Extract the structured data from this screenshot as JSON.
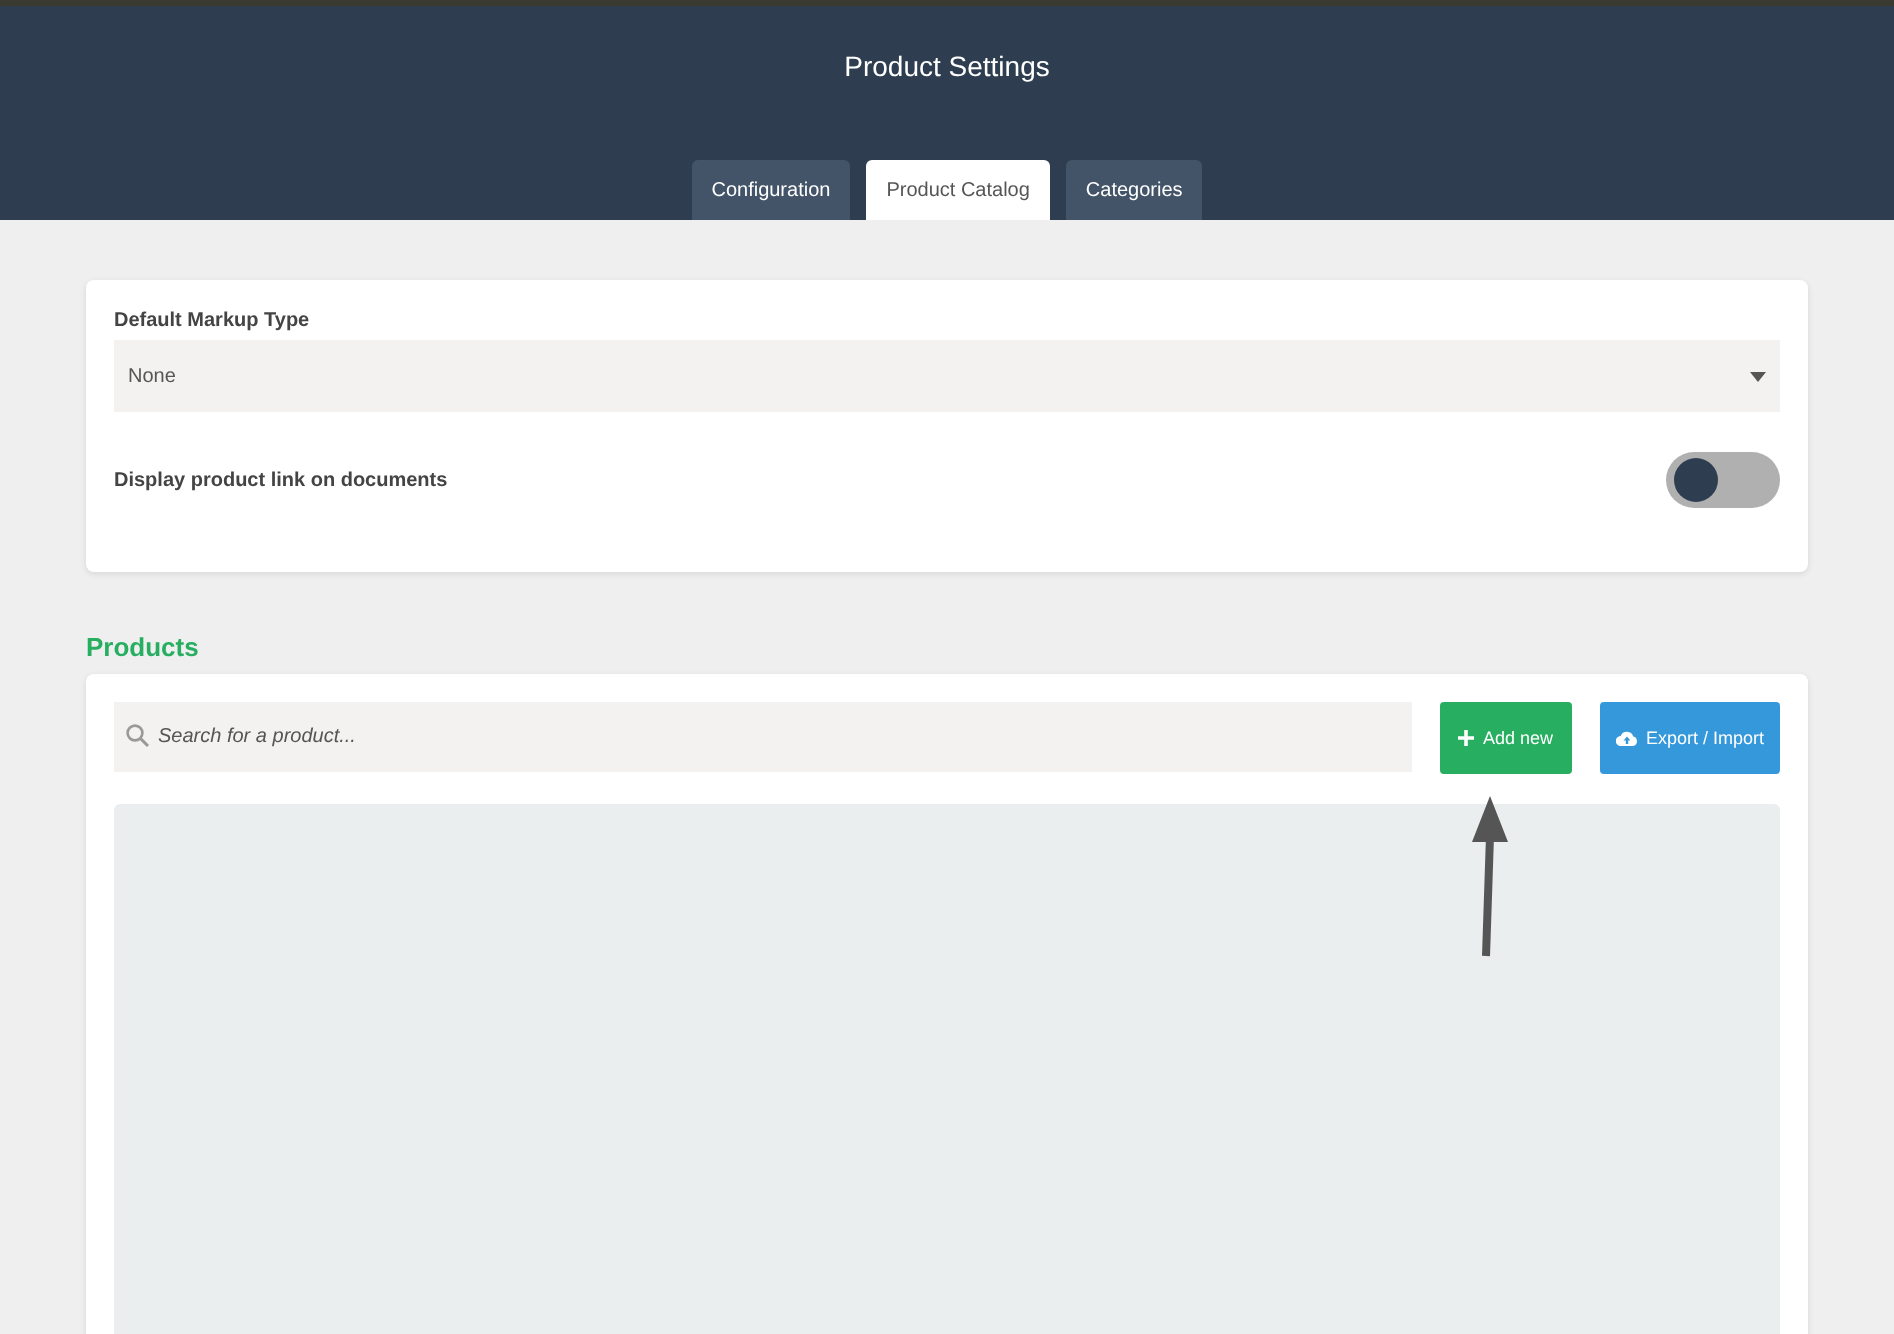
{
  "header": {
    "title": "Product Settings"
  },
  "tabs": [
    {
      "label": "Configuration",
      "selected": false
    },
    {
      "label": "Product Catalog",
      "selected": true
    },
    {
      "label": "Categories",
      "selected": false
    }
  ],
  "settings": {
    "markup_label": "Default Markup Type",
    "markup_value": "None",
    "link_label": "Display product link on documents",
    "link_on": false
  },
  "products": {
    "heading": "Products",
    "search": {
      "placeholder": "Search for a product..."
    },
    "buttons": [
      {
        "kind": "add",
        "label": "Add new"
      },
      {
        "kind": "export",
        "label": "Export / Import"
      }
    ]
  }
}
